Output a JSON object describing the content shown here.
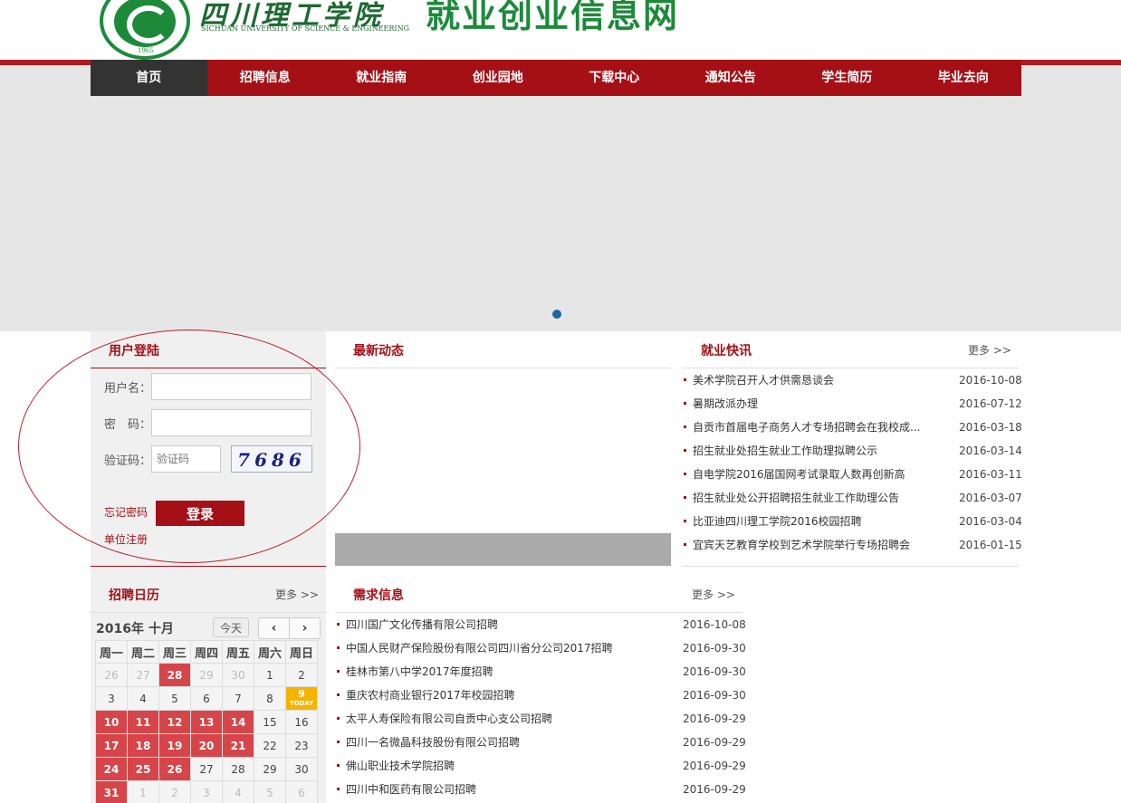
{
  "header": {
    "school_name_cn": "四川理工学院",
    "school_name_en": "SICHUAN UNIVERSITY OF SCIENCE & ENGINEERING",
    "seal_year": "1965",
    "site_title": "就业创业信息网"
  },
  "nav": {
    "items": [
      "首页",
      "招聘信息",
      "就业指南",
      "创业园地",
      "下载中心",
      "通知公告",
      "学生简历",
      "毕业去向"
    ],
    "active_index": 0
  },
  "login": {
    "title": "用户登陆",
    "username_label": "用户名：",
    "password_label": "密　码：",
    "captcha_label": "验证码：",
    "captcha_placeholder": "验证码",
    "captcha_text": "7686",
    "forgot_label": "忘记密码",
    "register_label": "单位注册",
    "login_button": "登录"
  },
  "latest": {
    "title": "最新动态"
  },
  "employment_news": {
    "title": "就业快讯",
    "more": "更多 >>",
    "items": [
      {
        "title": "美术学院召开人才供需恳谈会",
        "date": "2016-10-08"
      },
      {
        "title": "暑期改派办理",
        "date": "2016-07-12"
      },
      {
        "title": "自贡市首届电子商务人才专场招聘会在我校成...",
        "date": "2016-03-18"
      },
      {
        "title": "招生就业处招生就业工作助理拟聘公示",
        "date": "2016-03-14"
      },
      {
        "title": "自电学院2016届国网考试录取人数再创新高",
        "date": "2016-03-11"
      },
      {
        "title": "招生就业处公开招聘招生就业工作助理公告",
        "date": "2016-03-07"
      },
      {
        "title": "比亚迪四川理工学院2016校园招聘",
        "date": "2016-03-04"
      },
      {
        "title": "宜宾天艺教育学校到艺术学院举行专场招聘会",
        "date": "2016-01-15"
      }
    ]
  },
  "calendar": {
    "title": "招聘日历",
    "more": "更多 >>",
    "month_label": "2016年 十月",
    "today_button": "今天",
    "prev": "‹",
    "next": "›",
    "weekdays": [
      "周一",
      "周二",
      "周三",
      "周四",
      "周五",
      "周六",
      "周日"
    ],
    "today_tag": "TODAY",
    "weeks": [
      [
        {
          "d": "26",
          "s": "other"
        },
        {
          "d": "27",
          "s": "other"
        },
        {
          "d": "28",
          "s": "red"
        },
        {
          "d": "29",
          "s": "other"
        },
        {
          "d": "30",
          "s": "other"
        },
        {
          "d": "1",
          "s": ""
        },
        {
          "d": "2",
          "s": ""
        }
      ],
      [
        {
          "d": "3",
          "s": ""
        },
        {
          "d": "4",
          "s": ""
        },
        {
          "d": "5",
          "s": ""
        },
        {
          "d": "6",
          "s": ""
        },
        {
          "d": "7",
          "s": ""
        },
        {
          "d": "8",
          "s": ""
        },
        {
          "d": "9",
          "s": "today"
        }
      ],
      [
        {
          "d": "10",
          "s": "red"
        },
        {
          "d": "11",
          "s": "red"
        },
        {
          "d": "12",
          "s": "red"
        },
        {
          "d": "13",
          "s": "red"
        },
        {
          "d": "14",
          "s": "red"
        },
        {
          "d": "15",
          "s": ""
        },
        {
          "d": "16",
          "s": ""
        }
      ],
      [
        {
          "d": "17",
          "s": "red"
        },
        {
          "d": "18",
          "s": "red"
        },
        {
          "d": "19",
          "s": "red"
        },
        {
          "d": "20",
          "s": "red"
        },
        {
          "d": "21",
          "s": "red"
        },
        {
          "d": "22",
          "s": ""
        },
        {
          "d": "23",
          "s": ""
        }
      ],
      [
        {
          "d": "24",
          "s": "red"
        },
        {
          "d": "25",
          "s": "red"
        },
        {
          "d": "26",
          "s": "red"
        },
        {
          "d": "27",
          "s": ""
        },
        {
          "d": "28",
          "s": ""
        },
        {
          "d": "29",
          "s": ""
        },
        {
          "d": "30",
          "s": ""
        }
      ],
      [
        {
          "d": "31",
          "s": "red"
        },
        {
          "d": "1",
          "s": "other"
        },
        {
          "d": "2",
          "s": "other"
        },
        {
          "d": "3",
          "s": "other"
        },
        {
          "d": "4",
          "s": "other"
        },
        {
          "d": "5",
          "s": "other"
        },
        {
          "d": "6",
          "s": "other"
        }
      ]
    ]
  },
  "demand": {
    "title": "需求信息",
    "more": "更多 >>",
    "items": [
      {
        "title": "四川国广文化传播有限公司招聘",
        "date": "2016-10-08"
      },
      {
        "title": "中国人民财产保险股份有限公司四川省分公司2017招聘",
        "date": "2016-09-30"
      },
      {
        "title": "桂林市第八中学2017年度招聘",
        "date": "2016-09-30"
      },
      {
        "title": "重庆农村商业银行2017年校园招聘",
        "date": "2016-09-30"
      },
      {
        "title": "太平人寿保险有限公司自贡中心支公司招聘",
        "date": "2016-09-29"
      },
      {
        "title": "四川一名微晶科技股份有限公司招聘",
        "date": "2016-09-29"
      },
      {
        "title": "佛山职业技术学院招聘",
        "date": "2016-09-29"
      },
      {
        "title": "四川中和医药有限公司招聘",
        "date": "2016-09-29"
      }
    ]
  },
  "colors": {
    "brand_red": "#a50f16",
    "brand_green": "#1d8a3a",
    "today_yellow": "#f4b300"
  }
}
